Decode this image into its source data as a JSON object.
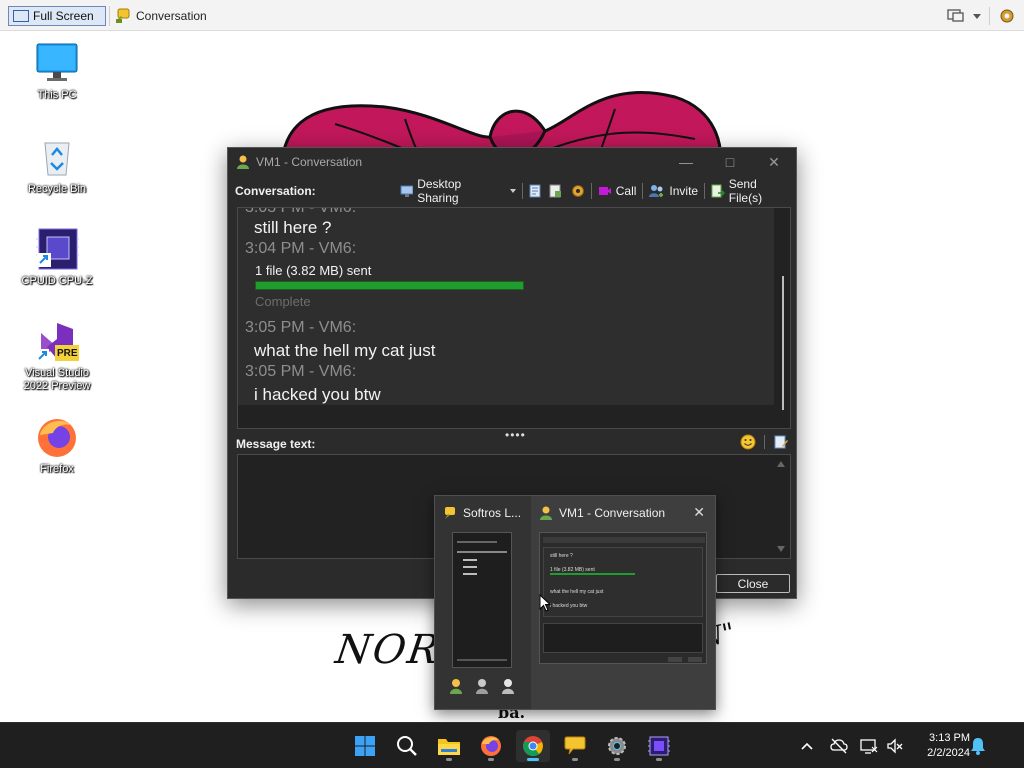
{
  "viewer": {
    "fullscreen_label": "Full Screen",
    "session_title": "Conversation"
  },
  "desktop_icons": [
    {
      "label": "This PC",
      "icon": "monitor-icon"
    },
    {
      "label": "Recycle Bin",
      "icon": "recycle-bin-icon"
    },
    {
      "label": "CPUID CPU-Z",
      "icon": "cpu-z-icon"
    },
    {
      "label": "Visual Studio 2022 Preview",
      "icon": "visual-studio-icon",
      "badge": "PRE"
    },
    {
      "label": "Firefox",
      "icon": "firefox-icon"
    }
  ],
  "wallpaper": {
    "scribble_main": "NOR",
    "scribble_right": "N\"",
    "scribble_bottom": "ba."
  },
  "conversation_window": {
    "title": "VM1 - Conversation",
    "toolbar_label": "Conversation:",
    "toolbar": {
      "desktop_sharing": "Desktop Sharing",
      "call": "Call",
      "invite": "Invite",
      "send_files": "Send File(s)"
    },
    "history": {
      "partial_header": "3:03 PM - VM6:",
      "messages": [
        {
          "text": "still here ?"
        },
        {
          "header": "3:04 PM - VM6:"
        },
        {
          "header": "3:05 PM - VM6:",
          "text": "what the hell my cat just"
        },
        {
          "header": "3:05 PM - VM6:",
          "text": "i hacked you btw"
        }
      ],
      "file_transfer": {
        "text": "1 file (3.82 MB) sent",
        "progress_percent": 100,
        "status": "Complete"
      }
    },
    "message_label": "Message text:",
    "close_label": "Close",
    "colors": {
      "background": "#2b2b2b",
      "progress": "#1f9d2f"
    }
  },
  "thumbnail_popup": {
    "left_title": "Softros L...",
    "right_title": "VM1 - Conversation",
    "mini_lines": [
      "still here ?",
      "1 file (3.82 MB) sent",
      "what the hell my cat just",
      "i hacked you btw"
    ]
  },
  "taskbar": {
    "apps": [
      "start-icon",
      "search-icon",
      "file-explorer-icon",
      "firefox-icon",
      "chrome-icon",
      "softros-messenger-icon",
      "settings-icon",
      "cpu-z-icon"
    ],
    "active_app": "chrome-icon",
    "time": "3:13 PM",
    "date": "2/2/2024"
  }
}
